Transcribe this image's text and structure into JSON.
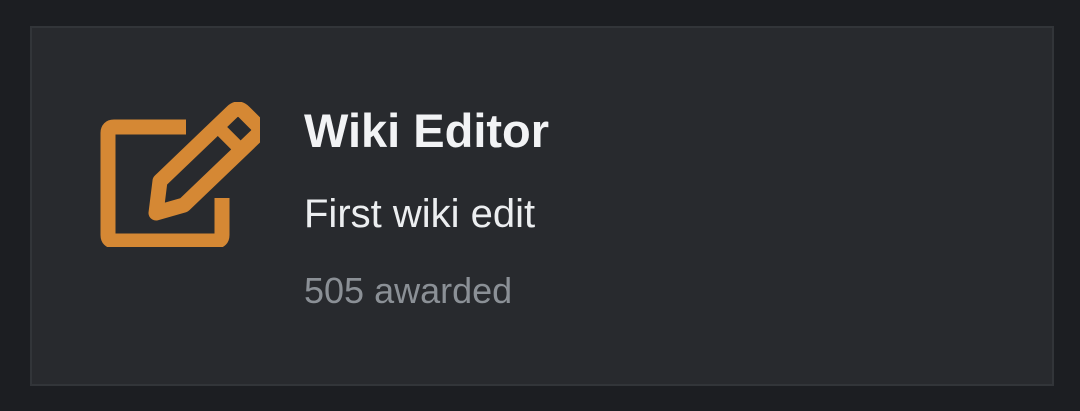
{
  "colors": {
    "page_background": "#1c1e22",
    "card_background": "#282a2e",
    "card_border": "#323539",
    "icon_accent": "#d58834",
    "title_text": "#f2f3f5",
    "muted_text": "#8b9096"
  },
  "badge": {
    "icon": "edit-pencil-icon",
    "title": "Wiki Editor",
    "description": "First wiki edit",
    "awarded": "505 awarded"
  }
}
